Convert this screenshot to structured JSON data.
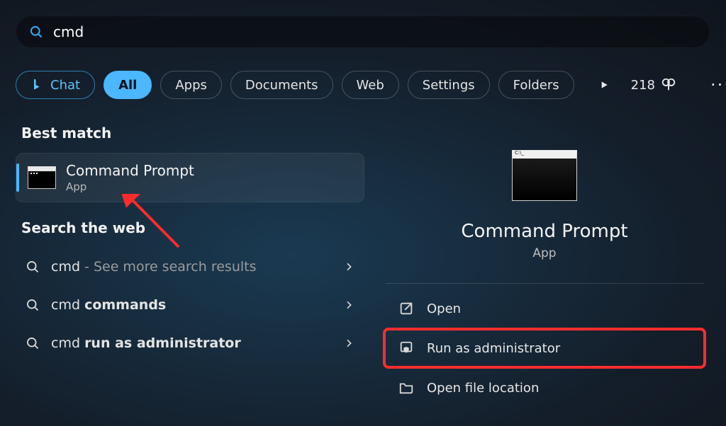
{
  "search": {
    "query": "cmd"
  },
  "tabs": {
    "chat": "Chat",
    "all": "All",
    "apps": "Apps",
    "documents": "Documents",
    "web": "Web",
    "settings": "Settings",
    "folders": "Folders"
  },
  "rewards": {
    "points": "218"
  },
  "left": {
    "best_match_heading": "Best match",
    "best_match": {
      "title": "Command Prompt",
      "subtitle": "App"
    },
    "search_web_heading": "Search the web",
    "web_items": [
      {
        "prefix": "cmd",
        "suffix_muted": " - See more search results",
        "suffix_bold": ""
      },
      {
        "prefix": "cmd ",
        "suffix_muted": "",
        "suffix_bold": "commands"
      },
      {
        "prefix": "cmd ",
        "suffix_muted": "",
        "suffix_bold": "run as administrator"
      }
    ]
  },
  "right": {
    "title": "Command Prompt",
    "subtitle": "App",
    "actions": [
      {
        "icon": "open-external",
        "label": "Open"
      },
      {
        "icon": "shield",
        "label": "Run as administrator"
      },
      {
        "icon": "folder",
        "label": "Open file location"
      }
    ]
  }
}
